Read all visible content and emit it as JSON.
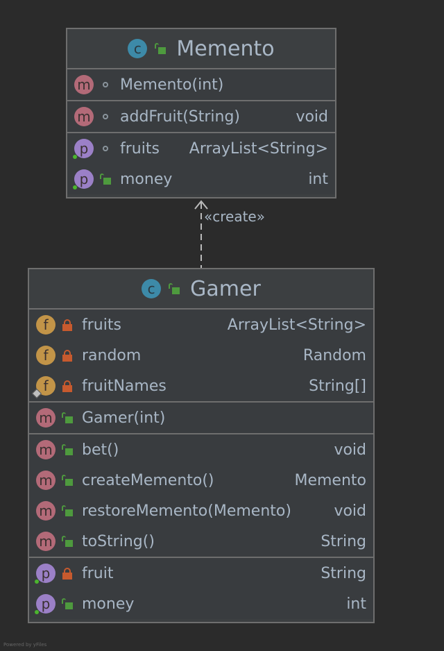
{
  "diagram": {
    "classes": [
      {
        "name": "Memento",
        "kind_icon": "class-icon",
        "visibility": "public",
        "sections": [
          [
            {
              "badge": "m",
              "badge_icon": "method-icon",
              "visibility": "package",
              "name": "Memento(int)",
              "type": ""
            }
          ],
          [
            {
              "badge": "m",
              "badge_icon": "method-icon",
              "visibility": "package",
              "name": "addFruit(String)",
              "type": "void"
            }
          ],
          [
            {
              "badge": "p",
              "badge_icon": "property-icon",
              "visibility": "package",
              "name": "fruits",
              "type": "ArrayList<String>"
            },
            {
              "badge": "p",
              "badge_icon": "property-icon",
              "visibility": "public",
              "name": "money",
              "type": "int"
            }
          ]
        ]
      },
      {
        "name": "Gamer",
        "kind_icon": "class-icon",
        "visibility": "public",
        "sections": [
          [
            {
              "badge": "f",
              "badge_icon": "field-icon",
              "visibility": "private",
              "name": "fruits",
              "type": "ArrayList<String>"
            },
            {
              "badge": "f",
              "badge_icon": "field-icon",
              "visibility": "private",
              "name": "random",
              "type": "Random"
            },
            {
              "badge": "f",
              "badge_icon": "field-icon",
              "visibility": "private",
              "name": "fruitNames",
              "type": "String[]",
              "static": true
            }
          ],
          [
            {
              "badge": "m",
              "badge_icon": "method-icon",
              "visibility": "public",
              "name": "Gamer(int)",
              "type": ""
            }
          ],
          [
            {
              "badge": "m",
              "badge_icon": "method-icon",
              "visibility": "public",
              "name": "bet()",
              "type": "void"
            },
            {
              "badge": "m",
              "badge_icon": "method-icon",
              "visibility": "public",
              "name": "createMemento()",
              "type": "Memento"
            },
            {
              "badge": "m",
              "badge_icon": "method-icon",
              "visibility": "public",
              "name": "restoreMemento(Memento)",
              "type": "void"
            },
            {
              "badge": "m",
              "badge_icon": "method-icon",
              "visibility": "public",
              "name": "toString()",
              "type": "String"
            }
          ],
          [
            {
              "badge": "p",
              "badge_icon": "property-icon",
              "visibility": "private",
              "name": "fruit",
              "type": "String"
            },
            {
              "badge": "p",
              "badge_icon": "property-icon",
              "visibility": "public",
              "name": "money",
              "type": "int"
            }
          ]
        ]
      }
    ],
    "edges": [
      {
        "from": "Gamer",
        "to": "Memento",
        "style": "dashed",
        "arrow": "open",
        "label": "«create»"
      }
    ]
  },
  "footer": "Powered by yFiles",
  "colors": {
    "background": "#2b2b2b",
    "class_fill": "#3c3f41",
    "border": "#6e6e6e",
    "text": "#a9b7c6",
    "method_badge": "#b36a78",
    "property_badge": "#9b80c7",
    "field_badge": "#c29448",
    "class_badge": "#3d8aa8",
    "public_lock": "#4e9a3e",
    "private_lock": "#c75a2e"
  }
}
